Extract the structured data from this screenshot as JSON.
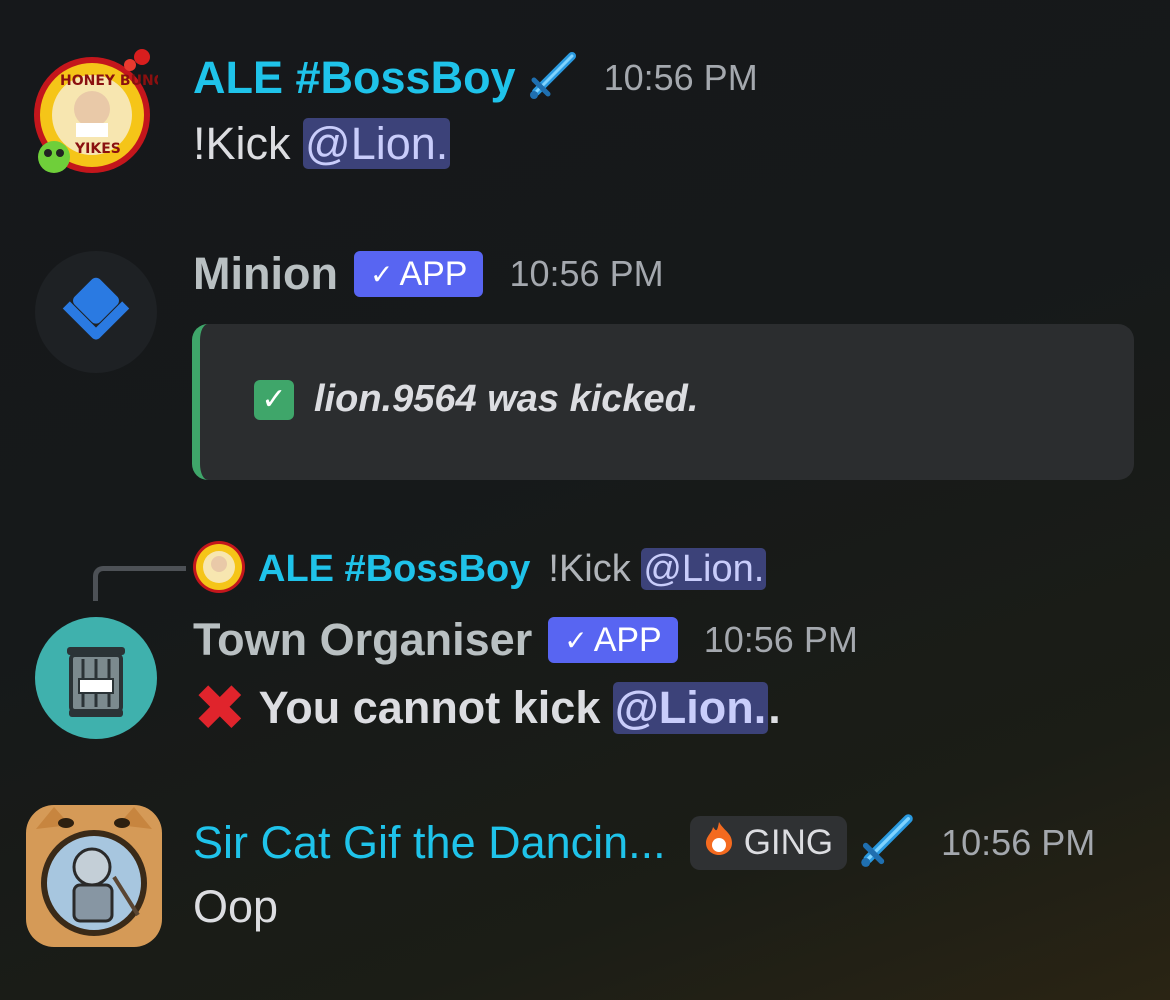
{
  "messages": [
    {
      "author": "ALE #BossBoy",
      "time": "10:56 PM",
      "avatar_icon": "honey-bunches-avatar",
      "content_prefix": "!Kick ",
      "mention": "@Lion."
    },
    {
      "author": "Minion",
      "badge": "APP",
      "time": "10:56 PM",
      "avatar_icon": "minion-bot-avatar",
      "embed_text": "lion.9564 was kicked."
    },
    {
      "reply": {
        "author": "ALE #BossBoy",
        "text": "!Kick ",
        "mention": "@Lion."
      },
      "author": "Town Organiser",
      "badge": "APP",
      "time": "10:56 PM",
      "avatar_icon": "town-organiser-avatar",
      "content_prefix": "You cannot kick ",
      "mention": "@Lion.",
      "content_suffix": "."
    },
    {
      "author": "Sir Cat Gif the Dancin...",
      "tag": "GING",
      "time": "10:56 PM",
      "avatar_icon": "cat-knight-avatar",
      "content": "Oop"
    }
  ],
  "colors": {
    "accent_cyan": "#1fc3ea",
    "app_badge": "#5865f2",
    "embed_border": "#3fa66a",
    "mention_bg": "#3c4279",
    "error_red": "#e0242c"
  }
}
